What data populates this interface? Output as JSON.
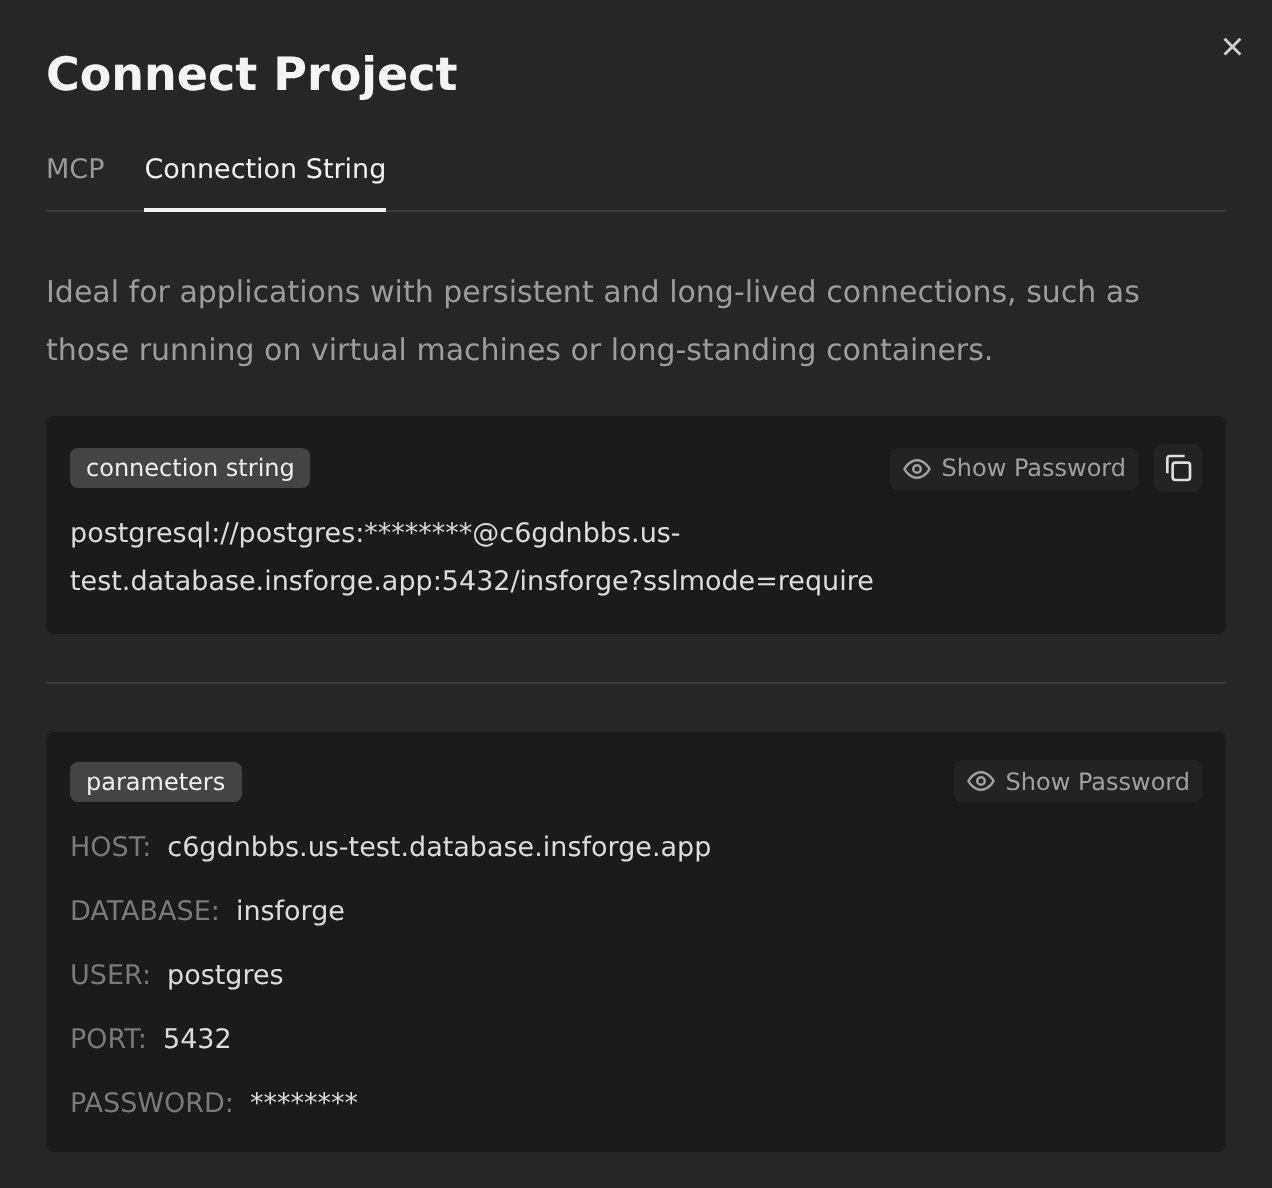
{
  "dialog": {
    "title": "Connect Project",
    "close": "×"
  },
  "tabs": [
    {
      "label": "MCP",
      "selected": false
    },
    {
      "label": "Connection String",
      "selected": true
    }
  ],
  "description": "Ideal for applications with persistent and long-lived connections, such as those running on virtual machines or long-standing containers.",
  "connection_card": {
    "tag": "connection string",
    "show_password": "Show Password",
    "value": "postgresql://postgres:********@c6gdnbbs.us-test.database.insforge.app:5432/insforge?sslmode=require"
  },
  "parameters_card": {
    "tag": "parameters",
    "show_password": "Show Password",
    "rows": [
      {
        "label": "HOST:",
        "value": "c6gdnbbs.us-test.database.insforge.app"
      },
      {
        "label": "DATABASE:",
        "value": "insforge"
      },
      {
        "label": "USER:",
        "value": "postgres"
      },
      {
        "label": "PORT:",
        "value": "5432"
      },
      {
        "label": "PASSWORD:",
        "value": "********"
      }
    ]
  }
}
